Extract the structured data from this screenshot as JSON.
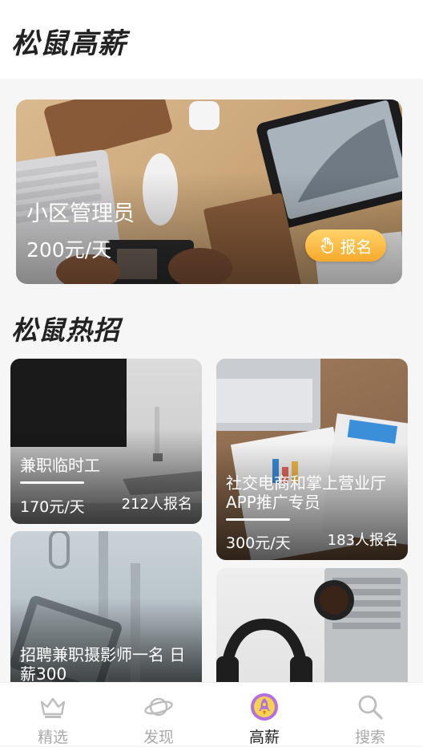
{
  "app": {
    "title": "松鼠高薪"
  },
  "featured": {
    "title": "小区管理员",
    "salary": "200元/天",
    "signup_label": "报名"
  },
  "section": {
    "title": "松鼠热招"
  },
  "jobs": [
    {
      "title": "兼职临时工",
      "pay": "170元/天",
      "applicants": "212人报名"
    },
    {
      "title": "社交电商和掌上营业厅APP推广专员",
      "pay": "300元/天",
      "applicants": "183人报名"
    },
    {
      "title": "招聘兼职摄影师一名 日薪300",
      "pay": "",
      "applicants": ""
    },
    {
      "title": "",
      "pay": "",
      "applicants": ""
    }
  ],
  "nav": [
    {
      "label": "精选",
      "icon": "crown-icon",
      "active": false
    },
    {
      "label": "发现",
      "icon": "planet-icon",
      "active": false
    },
    {
      "label": "高薪",
      "icon": "rocket-icon",
      "active": true
    },
    {
      "label": "搜索",
      "icon": "search-icon",
      "active": false
    }
  ],
  "colors": {
    "accent": "#f7a92a",
    "nav_active_bg": "#b46fe0",
    "nav_inactive": "#aaaaaa"
  }
}
